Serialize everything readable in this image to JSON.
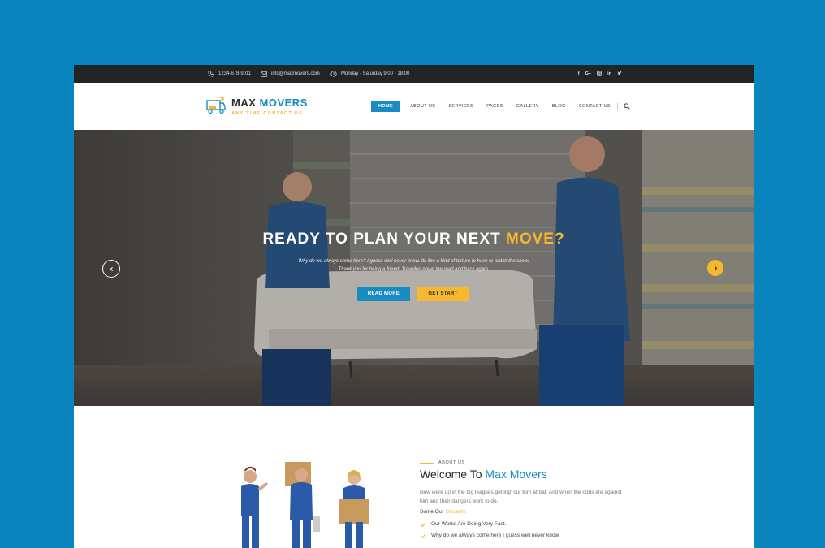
{
  "topbar": {
    "phone": "1234-678-9011",
    "email": "info@maxmovers.com",
    "hours": "Monday - Saturday 9:00 - 18:00",
    "social": [
      "f",
      "G+",
      "in",
      "in",
      "t"
    ]
  },
  "logo": {
    "title_part1": "MAX",
    "title_part2": "MOVERS",
    "tagline": "ANY TIME CONTACT US"
  },
  "nav": {
    "items": [
      "HOME",
      "ABOUT US",
      "SERVICES",
      "PAGES",
      "GALLERY",
      "BLOG",
      "CONTACT US"
    ],
    "active": "HOME"
  },
  "hero": {
    "title_part1": "READY TO PLAN YOUR NEXT",
    "title_part2": "MOVE?",
    "subtitle": "Why do we always come here? I guess well never know. Its like a kind of torture to have to watch the show. Thank you for being a friend. Travelled down the road and back again.",
    "btn_primary": "READ MORE",
    "btn_secondary": "GET START"
  },
  "about": {
    "label": "ABOUT US",
    "title_part1": "Welcome To",
    "title_part2": "Max Movers",
    "paragraph": "Now were up in the big leagues getting' our turn at bat. And when the odds are against him and their dangers work to do.",
    "sub_part1": "Some Our",
    "sub_part2": "Sincerity.",
    "checks": [
      "Our Works Are Doing Very Fast.",
      "Why do we always come here I guess well never know."
    ]
  },
  "colors": {
    "page_bg": "#0a84bd",
    "brand_blue": "#1a8bc2",
    "brand_yellow": "#f5b82e",
    "topbar_bg": "#222426"
  }
}
